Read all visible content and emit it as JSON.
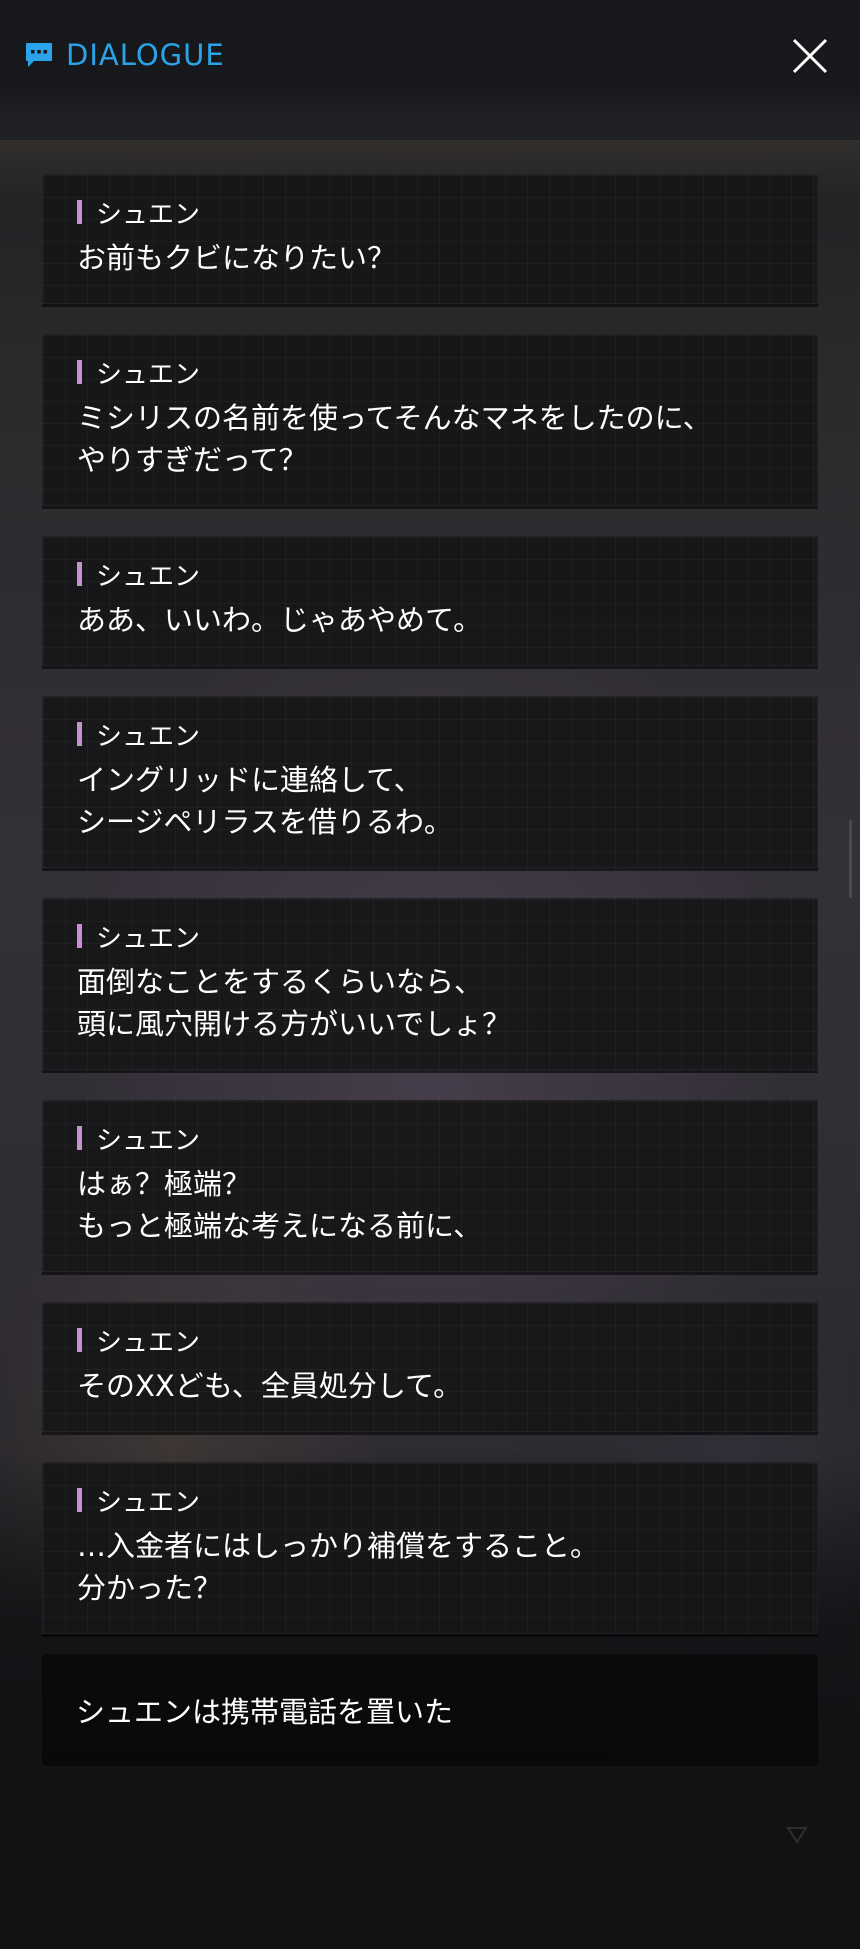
{
  "header": {
    "title": "DIALOGUE",
    "title_icon": "chat-bubble-icon",
    "close_icon": "close-icon",
    "accent_color": "#2aa3e8"
  },
  "dialogue": [
    {
      "speaker": "シュエン",
      "text": "お前もクビになりたい？"
    },
    {
      "speaker": "シュエン",
      "text": "ミシリスの名前を使ってそんなマネをしたのに、\nやりすぎだって？"
    },
    {
      "speaker": "シュエン",
      "text": "ああ、いいわ。じゃあやめて。"
    },
    {
      "speaker": "シュエン",
      "text": "イングリッドに連絡して、\nシージペリラスを借りるわ。"
    },
    {
      "speaker": "シュエン",
      "text": "面倒なことをするくらいなら、\n頭に風穴開ける方がいいでしょ？"
    },
    {
      "speaker": "シュエン",
      "text": "はぁ？極端？\nもっと極端な考えになる前に、"
    },
    {
      "speaker": "シュエン",
      "text": "そのXXども、全員処分して。"
    },
    {
      "speaker": "シュエン",
      "text": "…入金者にはしっかり補償をすること。\n分かった？"
    }
  ],
  "narration": {
    "text": "シュエンは携帯電話を置いた"
  },
  "speaker_marker_color": "#c88fd3",
  "next_icon": "triangle-down-icon"
}
